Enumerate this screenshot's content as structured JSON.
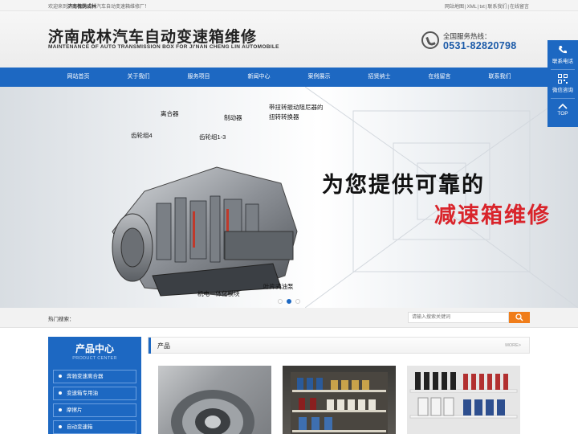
{
  "topbar": {
    "welcome_prefix": "欢迎来到",
    "welcome_company": "济南槐荫成林",
    "welcome_suffix": "汽车自动变速箱维修厂！",
    "links": [
      "网站地图",
      "XML",
      "txt",
      "联系我们",
      "在线留言"
    ]
  },
  "header": {
    "title": "济南成林汽车自动变速箱维修",
    "subtitle": "MAINTENANCE OF AUTO TRANSMISSION BOX FOR JI'NAN CHENG LIN AUTOMOBILE",
    "hotline_label": "全国服务热线：",
    "hotline_number": "0531-82820798"
  },
  "nav": {
    "items": [
      "网站首页",
      "关于我们",
      "服务项目",
      "新闻中心",
      "案例展示",
      "招贤纳士",
      "在线留言",
      "联系我们"
    ]
  },
  "banner": {
    "slogan_line1": "为您提供可靠的",
    "slogan_line2": "减速箱维修",
    "part_labels": {
      "clutch": "离合器",
      "brake": "制动器",
      "damper": "带扭转振动阻尼器的",
      "damper2": "扭转转换器",
      "gearset4": "齿轮组4",
      "gearset13": "齿轮组1-3",
      "pump": "叶片式油泵",
      "mechatronic": "机电一体化模块"
    },
    "slides": 3,
    "active_slide": 2,
    "accent_red": "#d9242b"
  },
  "search": {
    "hot_label": "热门搜索：",
    "placeholder": "请输入搜索关键词",
    "button_color": "#f07d1a"
  },
  "sidebar": {
    "title": "产品中心",
    "subtitle": "PRODUCT CENTER",
    "categories": [
      "奔驰变速离合器",
      "变速箱专用油",
      "摩擦片",
      "自动变速箱"
    ]
  },
  "products": {
    "section_title": "产品",
    "more_label": "MORE>"
  },
  "float_panel": {
    "contact_label": "联系电话",
    "wechat_label": "微信咨询",
    "top_label": "TOP"
  },
  "colors": {
    "brand_blue": "#1d68c2",
    "hotline_blue": "#1b5aa8"
  }
}
